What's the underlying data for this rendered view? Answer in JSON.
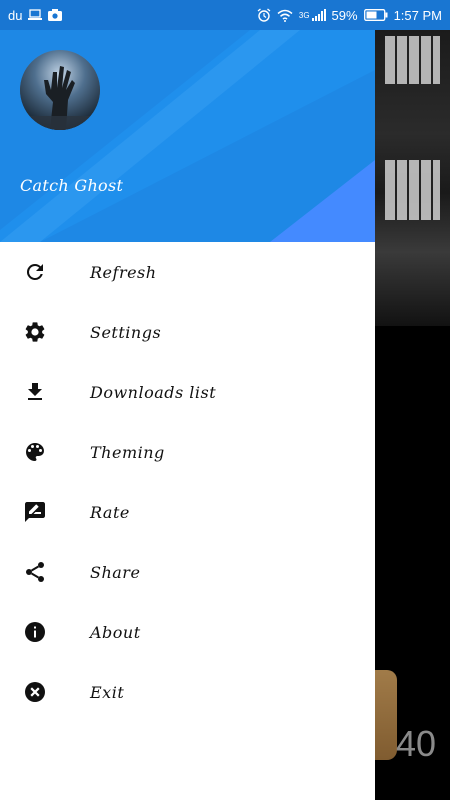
{
  "status_bar": {
    "carrier": "du",
    "battery": "59%",
    "time": "1:57 PM",
    "network": "3G"
  },
  "drawer": {
    "app_name": "Catch Ghost",
    "items": [
      {
        "label": "Refresh",
        "icon": "refresh-icon"
      },
      {
        "label": "Settings",
        "icon": "gear-icon"
      },
      {
        "label": "Downloads list",
        "icon": "download-icon"
      },
      {
        "label": "Theming",
        "icon": "palette-icon"
      },
      {
        "label": "Rate",
        "icon": "rate-review-icon"
      },
      {
        "label": "Share",
        "icon": "share-icon"
      },
      {
        "label": "About",
        "icon": "info-icon"
      },
      {
        "label": "Exit",
        "icon": "close-circle-icon"
      }
    ]
  },
  "background": {
    "score": "40"
  },
  "colors": {
    "status_bar": "#1976D2",
    "header": "#1E88E5",
    "accent": "#448AFF"
  }
}
